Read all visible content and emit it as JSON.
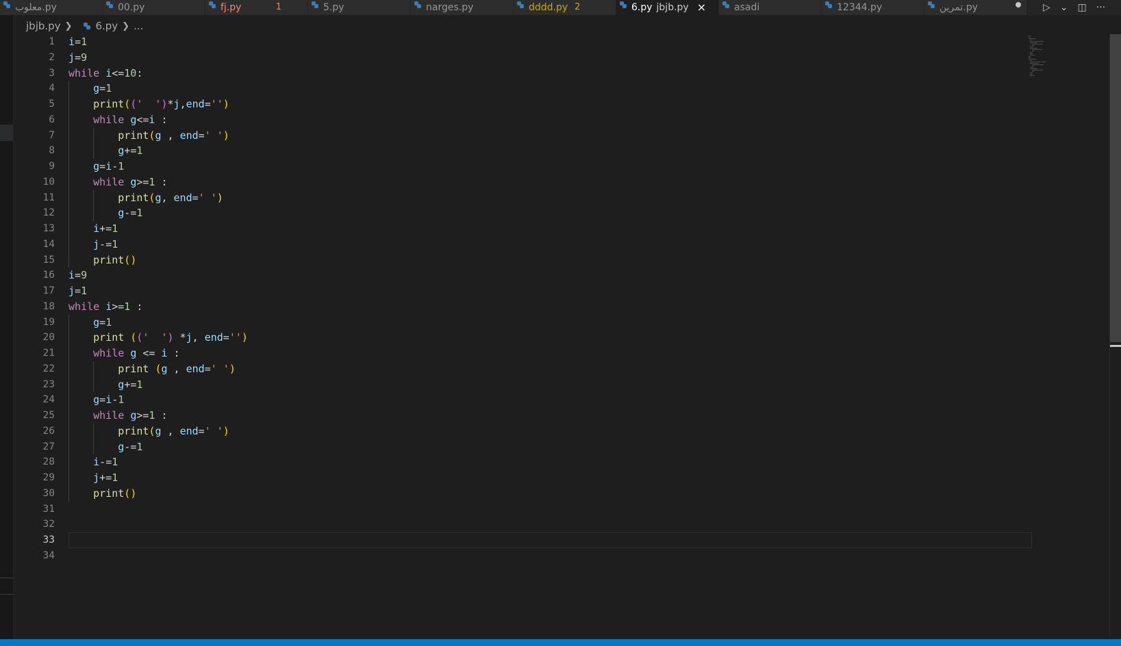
{
  "tabs": [
    {
      "label": "معلوب.py",
      "state": "normal"
    },
    {
      "label": "00.py",
      "state": "normal"
    },
    {
      "label": "fj.py",
      "state": "error",
      "badge": "1"
    },
    {
      "label": "5.py",
      "state": "normal"
    },
    {
      "label": "narges.py",
      "state": "normal"
    },
    {
      "label": "dddd.py",
      "state": "warning",
      "badge": "2"
    },
    {
      "label": "6.py",
      "state": "active",
      "description": "jbjb.py"
    },
    {
      "label": "asadi",
      "state": "normal"
    },
    {
      "label": "12344.py",
      "state": "normal"
    },
    {
      "label": "تمرين.py",
      "state": "dirty"
    }
  ],
  "active_tab_close": "×",
  "tab_actions": {
    "run": "▷",
    "run_menu": "⌄",
    "split": "◫",
    "more": "···"
  },
  "breadcrumb": {
    "folder": "jbjb.py",
    "file": "6.py",
    "symbol": "..."
  },
  "current_line": 33,
  "code_lines": [
    "i=1",
    "j=9",
    "while i<=10:",
    "    g=1",
    "    print(('  ')*j,end='')",
    "    while g<=i :",
    "        print(g , end=' ')",
    "        g+=1",
    "    g=i-1",
    "    while g>=1 :",
    "        print(g, end=' ')",
    "        g-=1",
    "    i+=1",
    "    j-=1",
    "    print()",
    "i=9",
    "j=1",
    "while i>=1 :",
    "    g=1",
    "    print (('  ') *j, end='')",
    "    while g <= i :",
    "        print (g , end=' ')",
    "        g+=1",
    "    g=i-1",
    "    while g>=1 :",
    "        print(g , end=' ')",
    "        g-=1",
    "    i-=1",
    "    j+=1",
    "    print()",
    "",
    "",
    "",
    ""
  ],
  "colors": {
    "keyword": "#c586c0",
    "function": "#dcdcaa",
    "number": "#b5cea8",
    "string": "#ce9178",
    "variable": "#9cdcfe",
    "bracket1": "#ffd700",
    "bracket2": "#da70d6",
    "status": "#007acc"
  }
}
